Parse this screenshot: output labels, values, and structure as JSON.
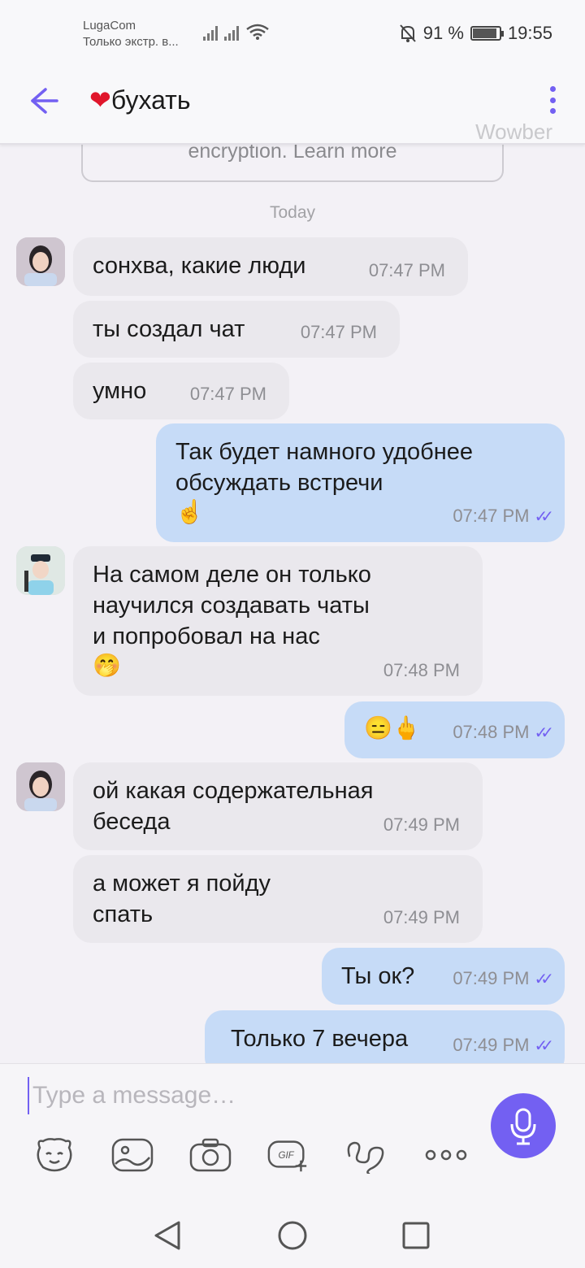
{
  "status_bar": {
    "carrier": "LugaCom",
    "carrier_sub": "Только экстр. в...",
    "battery": "91 %",
    "battery_level": 0.91,
    "clock": "19:55"
  },
  "header": {
    "heart": "❤",
    "title": "бухать",
    "watermark": "Wowber"
  },
  "banner": {
    "text": "encryption. Learn more"
  },
  "date_separator": "Today",
  "messages": [
    {
      "text": "сонхва, какие люди",
      "time": "07:47 PM"
    },
    {
      "text": "ты создал чат",
      "time": "07:47 PM"
    },
    {
      "text": "умно",
      "time": "07:47 PM"
    },
    {
      "text": "Так будет намного удобнее\n обсуждать встречи",
      "emoji": "☝",
      "time": "07:47 PM"
    },
    {
      "text": "На самом деле он только\nнаучился создавать чаты\nи попробовал на нас",
      "emoji": "🤭",
      "time": "07:48 PM"
    },
    {
      "text": "😑🖕",
      "time": "07:48 PM"
    },
    {
      "text": "ой какая содержательная\nбеседа",
      "time": "07:49 PM"
    },
    {
      "text": "а может я пойду\nспать",
      "time": "07:49 PM"
    },
    {
      "text": "Ты ок?",
      "time": "07:49 PM"
    },
    {
      "text": "Только 7 вечера",
      "time": "07:49 PM"
    }
  ],
  "composer": {
    "placeholder": "Type a message…",
    "gif_label": "GIF",
    "tools": [
      "sticker-icon",
      "gallery-icon",
      "camera-icon",
      "gif-icon",
      "doodle-icon",
      "more-icon"
    ]
  },
  "colors": {
    "accent": "#7360f2",
    "incoming_bubble": "#eae8ed",
    "outgoing_bubble": "#c6dbf7",
    "background": "#f3f1f6"
  }
}
